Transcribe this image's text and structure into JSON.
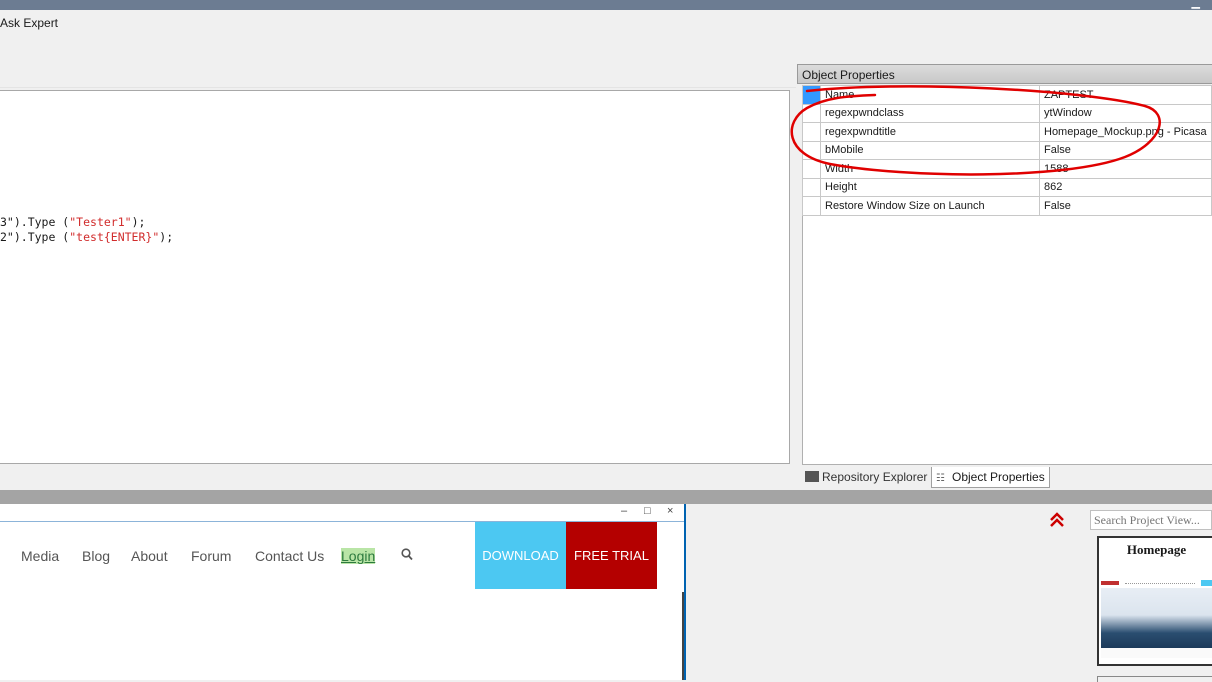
{
  "menubar": {
    "ask_expert": "Ask Expert"
  },
  "editor": {
    "line1": {
      "prefix": "3\").Type (",
      "arg": "\"Tester1\"",
      "suffix": ");"
    },
    "line2": {
      "prefix": "2\").Type (",
      "arg": "\"test{ENTER}\"",
      "suffix": ");"
    }
  },
  "object_properties": {
    "title": "Object Properties",
    "rows": [
      {
        "name": "Name",
        "value": "ZAPTEST"
      },
      {
        "name": "regexpwndclass",
        "value": "ytWindow"
      },
      {
        "name": "regexpwndtitle",
        "value": "Homepage_Mockup.png - Picasa"
      },
      {
        "name": "bMobile",
        "value": "False"
      },
      {
        "name": "Width",
        "value": "1588"
      },
      {
        "name": "Height",
        "value": "862"
      },
      {
        "name": "Restore Window Size on Launch",
        "value": "False"
      }
    ],
    "tabs": {
      "repository": "Repository Explorer",
      "properties": "Object Properties"
    }
  },
  "browser": {
    "window_controls": {
      "minimize": "–",
      "maximize": "□",
      "close": "×"
    },
    "nav": [
      "Media",
      "Blog",
      "About",
      "Forum",
      "Contact Us",
      "Login"
    ],
    "download": "DOWNLOAD",
    "free_trial": "FREE TRIAL"
  },
  "project_view": {
    "search_placeholder": "Search Project View...",
    "thumb_title": "Homepage"
  },
  "colors": {
    "titlebar": "#6c7c92",
    "download_btn": "#4cc8f2",
    "trial_btn": "#b40000",
    "annotation": "#e00000",
    "selected_row": "#3399ff"
  },
  "icons": {
    "search": "search-icon",
    "chevron": "chevron-double-up-icon"
  }
}
